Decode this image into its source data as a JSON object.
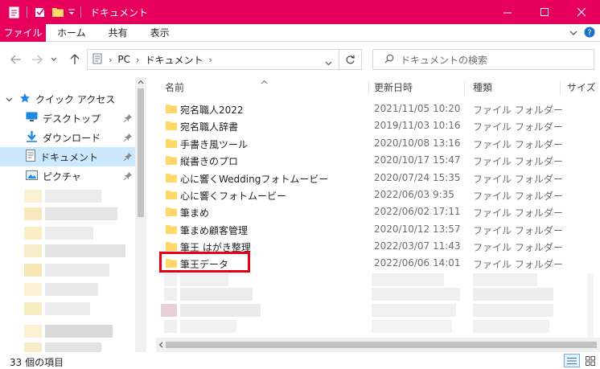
{
  "window": {
    "title": "ドキュメント"
  },
  "ribbon": {
    "tabs": [
      {
        "label": "ファイル"
      },
      {
        "label": "ホーム"
      },
      {
        "label": "共有"
      },
      {
        "label": "表示"
      }
    ]
  },
  "address": {
    "crumbs": [
      "PC",
      "ドキュメント"
    ]
  },
  "search": {
    "placeholder": "ドキュメントの検索"
  },
  "sidebar": {
    "quick_access": "クイック アクセス",
    "items": [
      {
        "label": "デスクトップ",
        "icon": "desktop-icon"
      },
      {
        "label": "ダウンロード",
        "icon": "download-arrow-icon"
      },
      {
        "label": "ドキュメント",
        "icon": "document-icon"
      },
      {
        "label": "ピクチャ",
        "icon": "picture-icon"
      }
    ]
  },
  "columns": {
    "name": "名前",
    "date": "更新日時",
    "type": "種類",
    "size": "サイズ"
  },
  "files": [
    {
      "name": "宛名職人2022",
      "date": "2021/11/05 10:20",
      "type": "ファイル フォルダー"
    },
    {
      "name": "宛名職人辞書",
      "date": "2019/11/03 10:16",
      "type": "ファイル フォルダー"
    },
    {
      "name": "手書き風ツール",
      "date": "2020/10/08 13:16",
      "type": "ファイル フォルダー"
    },
    {
      "name": "縦書きのプロ",
      "date": "2020/10/17 15:47",
      "type": "ファイル フォルダー"
    },
    {
      "name": "心に響くWeddingフォトムービー",
      "date": "2020/07/24 15:35",
      "type": "ファイル フォルダー"
    },
    {
      "name": "心に響くフォトムービー",
      "date": "2022/06/03 9:35",
      "type": "ファイル フォルダー"
    },
    {
      "name": "筆まめ",
      "date": "2022/06/02 17:11",
      "type": "ファイル フォルダー"
    },
    {
      "name": "筆まめ顧客管理",
      "date": "2020/10/12 13:57",
      "type": "ファイル フォルダー"
    },
    {
      "name": "筆王 はがき整理",
      "date": "2022/03/07 11:43",
      "type": "ファイル フォルダー"
    },
    {
      "name": "筆王データ",
      "date": "2022/06/06 14:01",
      "type": "ファイル フォルダー"
    }
  ],
  "status": {
    "item_count": "33 個の項目"
  },
  "colors": {
    "accent": "#e6005c",
    "selection": "#cce8ff",
    "highlight_box": "#e60012",
    "folder": "#ffd866"
  }
}
